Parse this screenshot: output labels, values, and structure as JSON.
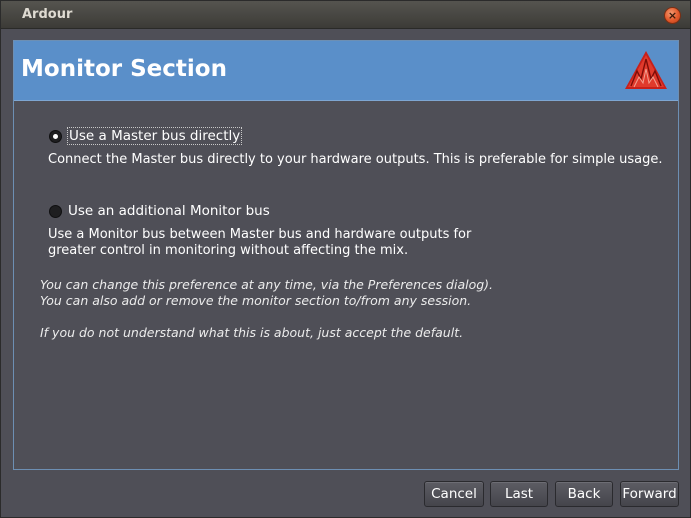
{
  "window": {
    "title": "Ardour"
  },
  "page": {
    "title": "Monitor Section"
  },
  "options": [
    {
      "label": "Use a Master bus directly",
      "selected": true,
      "description": [
        "Connect the Master bus directly to your hardware outputs. This is preferable for simple usage."
      ]
    },
    {
      "label": "Use an additional Monitor bus",
      "selected": false,
      "description": [
        "Use a Monitor bus between Master bus and hardware outputs for",
        "greater control in monitoring without affecting the mix."
      ]
    }
  ],
  "notes": [
    "You can change this preference at any time, via the Preferences dialog).",
    "You can also add or remove the monitor section to/from any session.",
    "If you do not understand what this is about, just accept the default."
  ],
  "buttons": {
    "cancel": "Cancel",
    "last": "Last",
    "back": "Back",
    "forward": "Forward"
  },
  "colors": {
    "header": "#5a8fc9",
    "background": "#4f4f57",
    "close": "#e2582a"
  }
}
